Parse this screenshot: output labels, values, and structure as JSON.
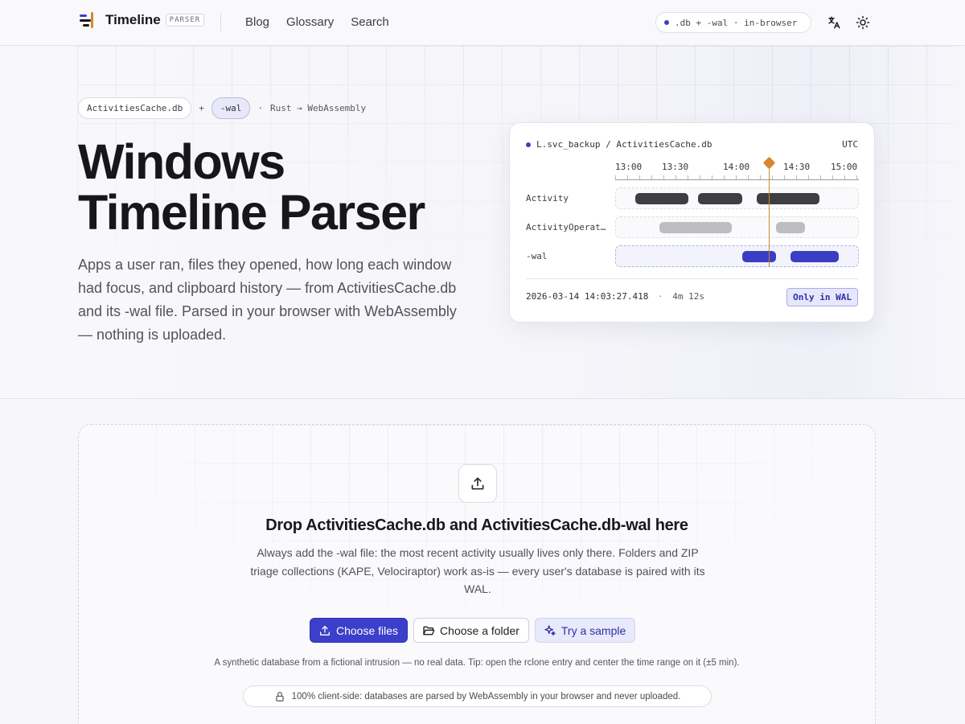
{
  "header": {
    "logo_name": "Timeline",
    "logo_badge": "PARSER",
    "nav": [
      "Blog",
      "Glossary",
      "Search"
    ],
    "pill": ".db + -wal · in-browser",
    "icons": [
      "translate-icon",
      "sun-icon"
    ]
  },
  "hero": {
    "crumbs": {
      "file": "ActivitiesCache.db",
      "plus": "+",
      "wal": "-wal",
      "sep": "·",
      "stack": "Rust → WebAssembly"
    },
    "title_line1": "Windows",
    "title_line2": "Timeline Parser",
    "description": "Apps a user ran, files they opened, how long each window had focus, and clipboard history — from ActivitiesCache.db and its -wal file. Parsed in your browser with WebAssembly — nothing is uploaded."
  },
  "card": {
    "path": "L.svc_backup / ActivitiesCache.db",
    "timezone": "UTC",
    "ticks": [
      "13:00",
      "13:30",
      "14:00",
      "14:30",
      "15:00"
    ],
    "rows": [
      {
        "label": "Activity",
        "kind": "dark",
        "segments": [
          [
            0.08,
            0.3
          ],
          [
            0.34,
            0.52
          ],
          [
            0.58,
            0.84
          ]
        ]
      },
      {
        "label": "ActivityOperation",
        "kind": "grey",
        "segments": [
          [
            0.18,
            0.48
          ],
          [
            0.66,
            0.78
          ]
        ]
      },
      {
        "label": "-wal",
        "kind": "blue",
        "segments": [
          [
            0.52,
            0.66
          ],
          [
            0.72,
            0.92
          ]
        ]
      }
    ],
    "cursor_fraction": 0.63,
    "footer_time": "2026-03-14 14:03:27.418",
    "footer_sep": "·",
    "footer_duration": "4m 12s",
    "badge": "Only in WAL",
    "colors": {
      "dark": "#3e3e44",
      "grey": "#bdbdc2",
      "blue": "#3a3ec4",
      "cursor": "#d8872a"
    }
  },
  "dropzone": {
    "title": "Drop ActivitiesCache.db and ActivitiesCache.db-wal here",
    "description": "Always add the -wal file: the most recent activity usually lives only there. Folders and ZIP triage collections (KAPE, Velociraptor) work as-is — every user's database is paired with its WAL.",
    "buttons": {
      "choose_files": "Choose files",
      "choose_folder": "Choose a folder",
      "try_sample": "Try a sample"
    },
    "note": "A synthetic database from a fictional intrusion — no real data. Tip: open the rclone entry and center the time range on it (±5 min).",
    "privacy": "100% client-side: databases are parsed by WebAssembly in your browser and never uploaded."
  },
  "accent_color": "#3b3fc9"
}
